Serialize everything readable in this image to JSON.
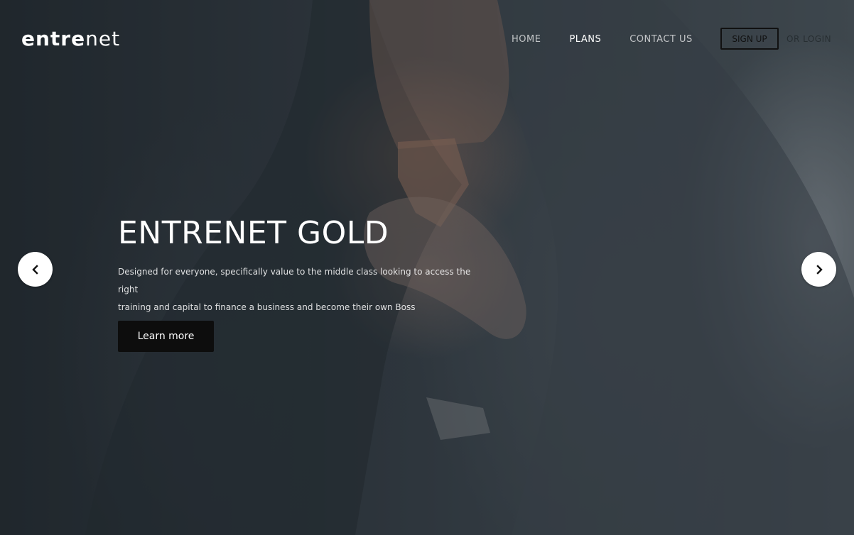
{
  "brand": {
    "logo_bold": "entre",
    "logo_light": "net"
  },
  "nav": {
    "items": [
      {
        "label": "HOME",
        "active": false
      },
      {
        "label": "PLANS",
        "active": true
      },
      {
        "label": "CONTACT US",
        "active": false
      }
    ],
    "signup_label": "SIGN UP",
    "login_label": "OR LOGIN"
  },
  "slide": {
    "title": "ENTRENET GOLD",
    "description_line1": "Designed for everyone, specifically value to the middle class looking to access the right",
    "description_line2": "training and capital to finance a business and become their own Boss",
    "cta_label": "Learn more"
  },
  "carousel": {
    "prev_icon": "chevron-left-icon",
    "next_icon": "chevron-right-icon"
  },
  "colors": {
    "cta_background": "#0d0d0d",
    "text_primary": "#ffffff"
  }
}
